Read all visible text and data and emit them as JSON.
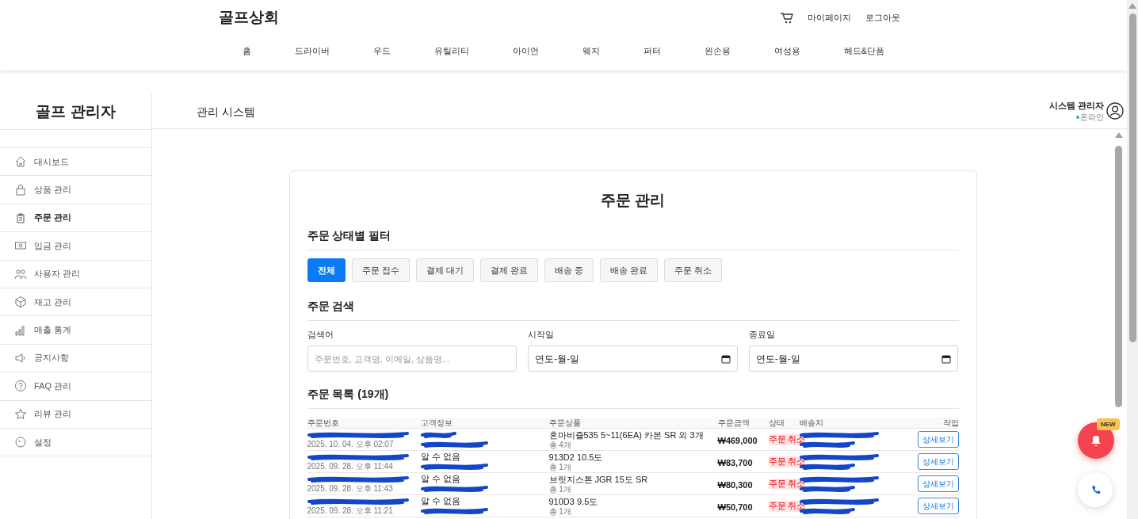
{
  "shop": {
    "logo": "골프상회",
    "links": [
      "마이페이지",
      "로그아웃"
    ],
    "nav": [
      "홈",
      "드라이버",
      "우드",
      "유틸리티",
      "아이언",
      "웨지",
      "퍼터",
      "왼손용",
      "여성용",
      "헤드&단품"
    ]
  },
  "admin": {
    "title": "골프 관리자",
    "header": "관리 시스템",
    "user": {
      "name": "시스템 관리자",
      "status": "온라인"
    }
  },
  "sidebar": {
    "items": [
      {
        "label": "대시보드",
        "selected": false
      },
      {
        "label": "상품 관리",
        "selected": false
      },
      {
        "label": "주문 관리",
        "selected": true
      },
      {
        "label": "입금 관리",
        "selected": false
      },
      {
        "label": "사용자 관리",
        "selected": false
      },
      {
        "label": "재고 관리",
        "selected": false
      },
      {
        "label": "매출 통계",
        "selected": false
      },
      {
        "label": "공지사항",
        "selected": false
      },
      {
        "label": "FAQ 관리",
        "selected": false
      },
      {
        "label": "리뷰 관리",
        "selected": false
      },
      {
        "label": "설정",
        "selected": false
      }
    ]
  },
  "orders": {
    "title": "주문 관리",
    "filter_title": "주문 상태별 필터",
    "filters": [
      {
        "label": "전체",
        "selected": true
      },
      {
        "label": "주문 접수",
        "selected": false
      },
      {
        "label": "결제 대기",
        "selected": false
      },
      {
        "label": "결제 완료",
        "selected": false
      },
      {
        "label": "배송 중",
        "selected": false
      },
      {
        "label": "배송 완료",
        "selected": false
      },
      {
        "label": "주문 취소",
        "selected": false
      }
    ],
    "search_title": "주문 검색",
    "fields": [
      {
        "label": "검색어",
        "kind": "text",
        "placeholder": "주문번호, 고객명, 이메일, 상품명..."
      },
      {
        "label": "시작일",
        "kind": "date",
        "placeholder": "연도-월-일"
      },
      {
        "label": "종료일",
        "kind": "date",
        "placeholder": "연도-월-일"
      }
    ],
    "list_title": "주문 목록 (19개)",
    "table": {
      "columns": [
        "주문번호",
        "고객정보",
        "주문상품",
        "주문금액",
        "상태",
        "배송지",
        "작업"
      ],
      "rows": [
        {
          "date": "2025. 10. 04. 오후 02:07",
          "product": "혼마비즐535 5~11(6EA) 카본 SR 외 3개",
          "count": "총 4개",
          "amount": "₩469,000",
          "status": {
            "label": "주문 취소",
            "kind": "cancelled"
          },
          "action": "상세보기"
        },
        {
          "date": "2025. 09. 28. 오후 11:44",
          "customer": "알 수 없음",
          "product": "913D2 10.5도",
          "count": "총 1개",
          "amount": "₩83,700",
          "status": {
            "label": "주문 취소",
            "kind": "cancelled"
          },
          "action": "상세보기"
        },
        {
          "date": "2025. 09. 28. 오후 11:43",
          "customer": "알 수 없음",
          "product": "브릿지스톤 JGR 15도 SR",
          "count": "총 1개",
          "amount": "₩80,300",
          "status": {
            "label": "주문 취소",
            "kind": "cancelled"
          },
          "action": "상세보기"
        },
        {
          "date": "2025. 09. 28. 오후 11:21",
          "customer": "알 수 없음",
          "product": "910D3 9.5도",
          "count": "총 1개",
          "amount": "₩50,700",
          "status": {
            "label": "주문 취소",
            "kind": "cancelled"
          },
          "action": "상세보기"
        }
      ]
    }
  },
  "floating": {
    "badge": "NEW"
  }
}
